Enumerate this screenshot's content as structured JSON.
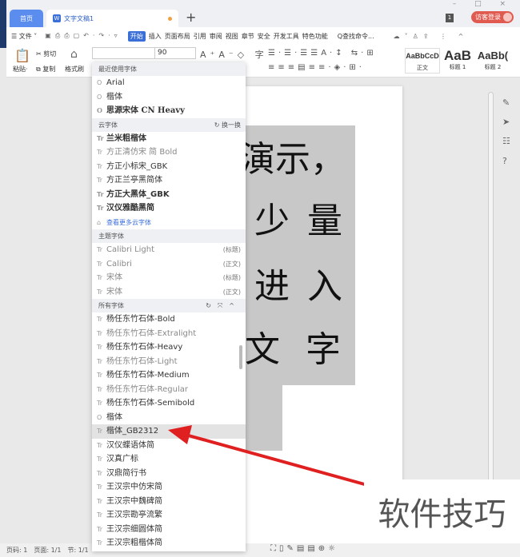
{
  "tabs": {
    "home": "首页",
    "doc": "文字文稿1",
    "new": "+"
  },
  "window": {
    "controls": "– □ ×",
    "badge": "1",
    "login": "访客登录"
  },
  "menu": {
    "file": "☰ 文件 ˅",
    "items": [
      "开始",
      "插入",
      "页面布局",
      "引用",
      "审阅",
      "视图",
      "章节",
      "安全",
      "开发工具",
      "特色功能"
    ],
    "active": "开始",
    "search": "Q查找命令..."
  },
  "ribbon": {
    "cut": "✂ 剪切",
    "paste": "粘贴·",
    "copy": "复制",
    "format_painter": "格式刷",
    "font_name": "",
    "font_size": "90",
    "styles": [
      {
        "sample": "AaBbCcD",
        "label": "正文"
      },
      {
        "sample": "AaB",
        "label": "标题 1"
      },
      {
        "sample": "AaBb(",
        "label": "标题 2"
      }
    ]
  },
  "font_dropdown": {
    "recent_header": "最近使用字体",
    "recent": [
      "Arial",
      "楷体",
      "思源宋体 CN Heavy"
    ],
    "cloud_header": "云字体",
    "cloud_refresh": "换一换",
    "cloud": [
      "兰米粗楷体",
      "方正清仿宋 简 Bold",
      "方正小标宋_GBK",
      "方正兰亭黑简体",
      "方正大黑体_GBK",
      "汉仪雅酷黑简"
    ],
    "more_cloud": "查看更多云字体",
    "theme_header": "主题字体",
    "theme": [
      {
        "name": "Calibri Light",
        "tag": "(标题)"
      },
      {
        "name": "Calibri",
        "tag": "(正文)"
      },
      {
        "name": "宋体",
        "tag": "(标题)"
      },
      {
        "name": "宋体",
        "tag": "(正文)"
      }
    ],
    "all_header": "所有字体",
    "all": [
      "杨任东竹石体-Bold",
      "杨任东竹石体-Extralight",
      "杨任东竹石体-Heavy",
      "杨任东竹石体-Light",
      "杨任东竹石体-Medium",
      "杨任东竹石体-Regular",
      "杨任东竹石体-Semibold",
      "楷体",
      "楷体_GB2312",
      "汉仪蝶语体简",
      "汉真广标",
      "汉鼎简行书",
      "王汉宗中仿宋简",
      "王汉宗中魏碑简",
      "王汉宗勘亭流繁",
      "王汉宗细圆体简",
      "王汉宗粗楷体简"
    ],
    "selected": "楷体_GB2312"
  },
  "document": {
    "lines": [
      "演示，",
      "少 量",
      "进 入",
      "文 字"
    ]
  },
  "status": {
    "page_num": "页码: 1",
    "pages": "页面: 1/1",
    "section": "节: 1/1"
  },
  "watermark": "软件技巧",
  "colors": {
    "accent": "#3b6fd8",
    "arrow": "#e02020",
    "login": "#e05a50"
  }
}
